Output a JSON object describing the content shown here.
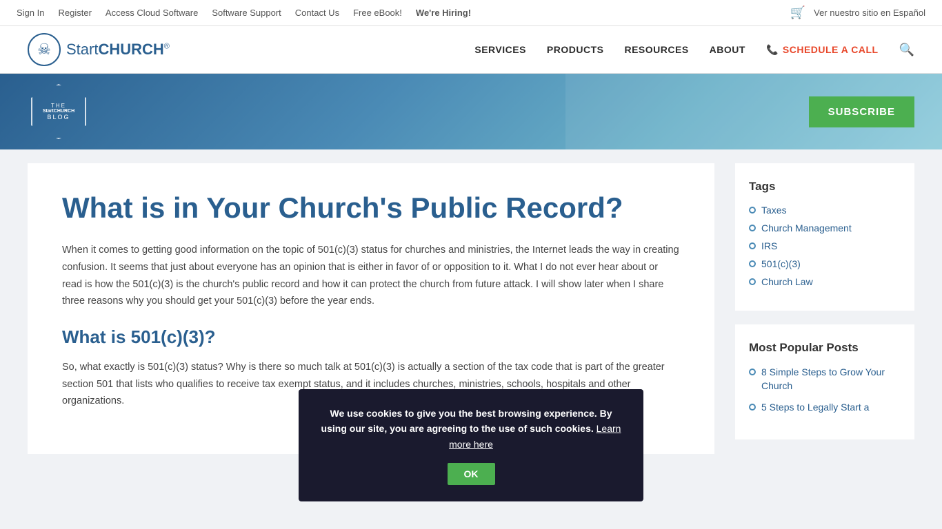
{
  "topbar": {
    "links": [
      {
        "label": "Sign In",
        "name": "sign-in"
      },
      {
        "label": "Register",
        "name": "register"
      },
      {
        "label": "Access Cloud Software",
        "name": "cloud-software"
      },
      {
        "label": "Software Support",
        "name": "software-support"
      },
      {
        "label": "Contact Us",
        "name": "contact-us"
      },
      {
        "label": "Free eBook!",
        "name": "free-ebook"
      },
      {
        "label": "We're Hiring!",
        "name": "were-hiring"
      }
    ],
    "spanish_link": "Ver nuestro sitio en Español"
  },
  "nav": {
    "logo_text_start": "Start",
    "logo_text_end": "CHURCH",
    "logo_reg": "®",
    "links": [
      {
        "label": "SERVICES",
        "name": "services"
      },
      {
        "label": "PRODUCTS",
        "name": "products"
      },
      {
        "label": "RESOURCES",
        "name": "resources"
      },
      {
        "label": "ABOUT",
        "name": "about"
      }
    ],
    "schedule_label": "SCHEDULE A CALL"
  },
  "hero": {
    "blog_the": "THE",
    "blog_sc": "StartCHURCH",
    "blog_label": "BLOG",
    "subscribe_label": "SUBSCRIBE"
  },
  "article": {
    "title": "What is in Your Church's Public Record?",
    "body_1": "When it comes to getting good information on the topic of 501(c)(3) status for churches and ministries, the Internet leads the way in creating confusion.  It seems that just about everyone has an opinion that is either in favor of or opposition to it.  What I do not ever hear about or read is how the 501(c)(3) is the church's public record and how it can protect the church from future attack.  I will show later when I share three reasons why you should get your 501(c)(3) before the year ends.",
    "subheading_1": "What is 501(c)(3)?",
    "body_2": "So, what exactly is 501(c)(3) status? Why is there so much talk at 501(c)(3) is actually a section of the tax code that is part of the greater section 501 that lists who qualifies to receive tax exempt status, and it includes churches, ministries, schools, hospitals and other organizations."
  },
  "sidebar": {
    "tags_title": "Tags",
    "tags": [
      {
        "label": "Taxes",
        "name": "tag-taxes"
      },
      {
        "label": "Church Management",
        "name": "tag-church-management"
      },
      {
        "label": "IRS",
        "name": "tag-irs"
      },
      {
        "label": "501(c)(3)",
        "name": "tag-501c3"
      },
      {
        "label": "Church Law",
        "name": "tag-church-law"
      }
    ],
    "popular_title": "Most Popular Posts",
    "popular_posts": [
      {
        "label": "8 Simple Steps to Grow Your Church",
        "name": "popular-grow-church"
      },
      {
        "label": "5 Steps to Legally Start a",
        "name": "popular-start-church"
      }
    ]
  },
  "cookie": {
    "text_bold": "We use cookies to give you the best browsing experience. By using our site, you are agreeing to the use of such cookies.",
    "link_text": "Learn more here",
    "ok_label": "OK"
  }
}
